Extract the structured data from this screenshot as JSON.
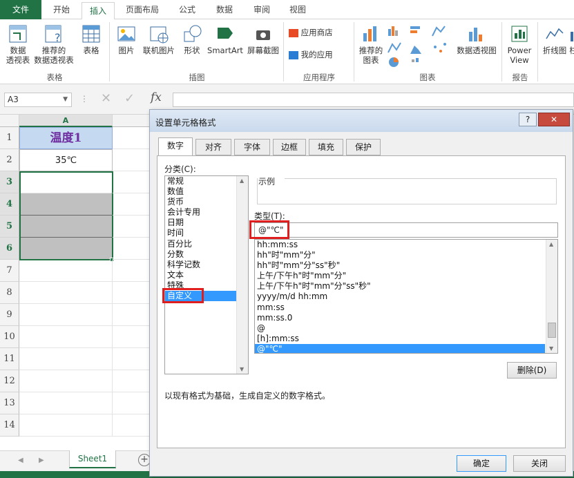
{
  "ribbon_tabs": [
    "文件",
    "开始",
    "插入",
    "页面布局",
    "公式",
    "数据",
    "审阅",
    "视图"
  ],
  "active_ribbon_tab": "插入",
  "ribbon": {
    "pivot_table": "数据\n透视表",
    "recommended_pivot": "推荐的\n数据透视表",
    "table": "表格",
    "group_tables": "表格",
    "picture": "图片",
    "online_picture": "联机图片",
    "shapes": "形状",
    "smartart": "SmartArt",
    "screenshot": "屏幕截图",
    "group_illustrations": "插图",
    "app_store": "应用商店",
    "my_apps": "我的应用",
    "group_apps": "应用程序",
    "recommended_charts": "推荐的\n图表",
    "pivot_chart": "数据透视图",
    "group_charts": "图表",
    "power_view": "Power\nView",
    "group_reports": "报告",
    "sparkline_line": "折线图",
    "sparkline_more": "柱"
  },
  "namebox": "A3",
  "fx_label": "fx",
  "sheet": {
    "col_header": "A",
    "rows": [
      "1",
      "2",
      "3",
      "4",
      "5",
      "6",
      "7",
      "8",
      "9",
      "10",
      "11",
      "12",
      "13",
      "14"
    ],
    "a1": "温度1",
    "a2": "35℃",
    "sheet_tab": "Sheet1"
  },
  "dialog": {
    "title": "设置单元格格式",
    "help": "?",
    "close": "✕",
    "tabs": [
      "数字",
      "对齐",
      "字体",
      "边框",
      "填充",
      "保护"
    ],
    "active_tab": "数字",
    "category_label": "分类(C):",
    "categories": [
      "常规",
      "数值",
      "货币",
      "会计专用",
      "日期",
      "时间",
      "百分比",
      "分数",
      "科学记数",
      "文本",
      "特殊",
      "自定义"
    ],
    "selected_category": "自定义",
    "sample_label": "示例",
    "type_label": "类型(T):",
    "type_value": "@\"℃\"",
    "type_list": [
      "hh:mm:ss",
      "hh\"时\"mm\"分\"",
      "hh\"时\"mm\"分\"ss\"秒\"",
      "上午/下午h\"时\"mm\"分\"",
      "上午/下午h\"时\"mm\"分\"ss\"秒\"",
      "yyyy/m/d hh:mm",
      "mm:ss",
      "mm:ss.0",
      "@",
      "[h]:mm:ss",
      "@\"℃\""
    ],
    "selected_type": "@\"℃\"",
    "delete_button": "删除(D)",
    "description": "以现有格式为基础，生成自定义的数字格式。",
    "ok_button": "确定",
    "cancel_button": "关闭"
  },
  "colors": {
    "excel_green": "#217346",
    "selection_blue": "#3399ff",
    "highlight_red": "#e01e1e",
    "header_fill": "#c5d9f1",
    "gray_fill": "#c0c0c0",
    "title_purple": "#7030a0"
  }
}
